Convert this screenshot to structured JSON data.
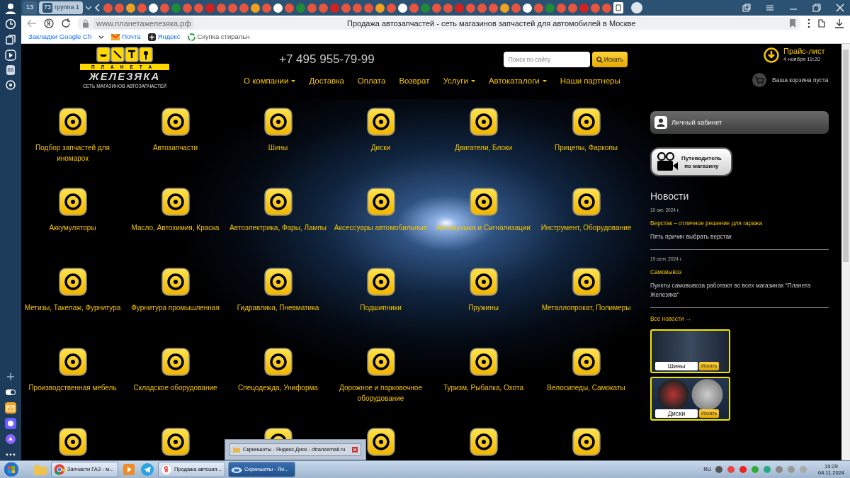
{
  "browser": {
    "tab_counter": "13",
    "group": {
      "count": "73",
      "label": "группа 1"
    },
    "url": "www.планетажелезяка.рф",
    "page_title": "Продажа автозапчастей - сеть магазинов запчастей для автомобилей в Москве",
    "sidebar_badge": "86",
    "bookmarks": [
      {
        "label": "Закладки Google Ch",
        "kind": "folder"
      },
      {
        "label": "Почта",
        "kind": "mail"
      },
      {
        "label": "Яндекс",
        "kind": "yandex"
      },
      {
        "label": "Скупка стиральн",
        "kind": "recycle"
      }
    ]
  },
  "site": {
    "logo": {
      "top": "ПЛАНЕТА",
      "name": "ЖЕЛЕЗЯКА",
      "tagline": "СЕТЬ МАГАЗИНОВ АВТОЗАПЧАСТЕЙ"
    },
    "phone": "+7 495 955-79-99",
    "nav": [
      {
        "label": "О компании",
        "dropdown": true
      },
      {
        "label": "Доставка",
        "dropdown": false
      },
      {
        "label": "Оплата",
        "dropdown": false
      },
      {
        "label": "Возврат",
        "dropdown": false
      },
      {
        "label": "Услуги",
        "dropdown": true
      },
      {
        "label": "Автокаталоги",
        "dropdown": true
      },
      {
        "label": "Наши партнеры",
        "dropdown": false
      }
    ],
    "search": {
      "placeholder": "Поиск по сайту",
      "button": "Искать"
    },
    "price_list": {
      "title": "Прайс-лист",
      "date": "4 ноября 19:20"
    },
    "cart": "Ваша корзина пуста"
  },
  "categories": [
    {
      "label": "Подбор запчастей для иномарок"
    },
    {
      "label": "Автозапчасти"
    },
    {
      "label": "Шины"
    },
    {
      "label": "Диски"
    },
    {
      "label": "Двигатели, Блоки"
    },
    {
      "label": "Прицепы, Фаркопы"
    },
    {
      "label": "Аккумуляторы"
    },
    {
      "label": "Масло, Автохимия, Краска"
    },
    {
      "label": "Автоэлектрика, Фары, Лампы"
    },
    {
      "label": "Аксессуары автомобильные"
    },
    {
      "label": "Автомузыка и Сигнализации"
    },
    {
      "label": "Инструмент, Оборудование"
    },
    {
      "label": "Метизы, Такелаж, Фурнитура"
    },
    {
      "label": "Фурнитура промышленная"
    },
    {
      "label": "Гидравлика, Пневматика"
    },
    {
      "label": "Подшипники"
    },
    {
      "label": "Пружины"
    },
    {
      "label": "Металлопрокат, Полимеры"
    },
    {
      "label": "Производственная мебель"
    },
    {
      "label": "Складское оборудование"
    },
    {
      "label": "Спецодежда, Униформа"
    },
    {
      "label": "Дорожное и парковочное оборудование"
    },
    {
      "label": "Туризм, Рыбалка, Охота"
    },
    {
      "label": "Велосипеды, Самокаты"
    }
  ],
  "sidebar": {
    "account": "Личный кабинет",
    "guide": [
      "Путеводитель",
      "по магазину"
    ],
    "news_title": "Новости",
    "news": [
      {
        "date": "10 окт. 2024 г.",
        "title": "Верстак – отличное решение для гаража",
        "text": "Пять причин выбрать верстак"
      },
      {
        "date": "19 сент. 2024 г.",
        "title": "Самовывоз",
        "text": "Пункты самовывоза работают во всех магазинах \"Планета Железяка\""
      }
    ],
    "all_news": "Все новости →",
    "promos": [
      {
        "kind": "tires",
        "label": "Шины",
        "button": "Искать"
      },
      {
        "kind": "wheels",
        "label": "Диски",
        "button": "Искать"
      }
    ]
  },
  "preview_popup": {
    "title": "Скриншоты - Яндекс.Диск - dtrancemail.ru"
  },
  "taskbar": {
    "items": [
      {
        "label": "Запчасти ГАЗ - м...",
        "kind": "chrome",
        "selected": false
      },
      {
        "label": "Продажа автозап...",
        "kind": "yandex",
        "selected": false
      },
      {
        "label": "Скриншоты - Ян...",
        "kind": "disk",
        "selected": true
      }
    ],
    "language": "RU",
    "time": "19:29",
    "date": "04.11.2024"
  }
}
